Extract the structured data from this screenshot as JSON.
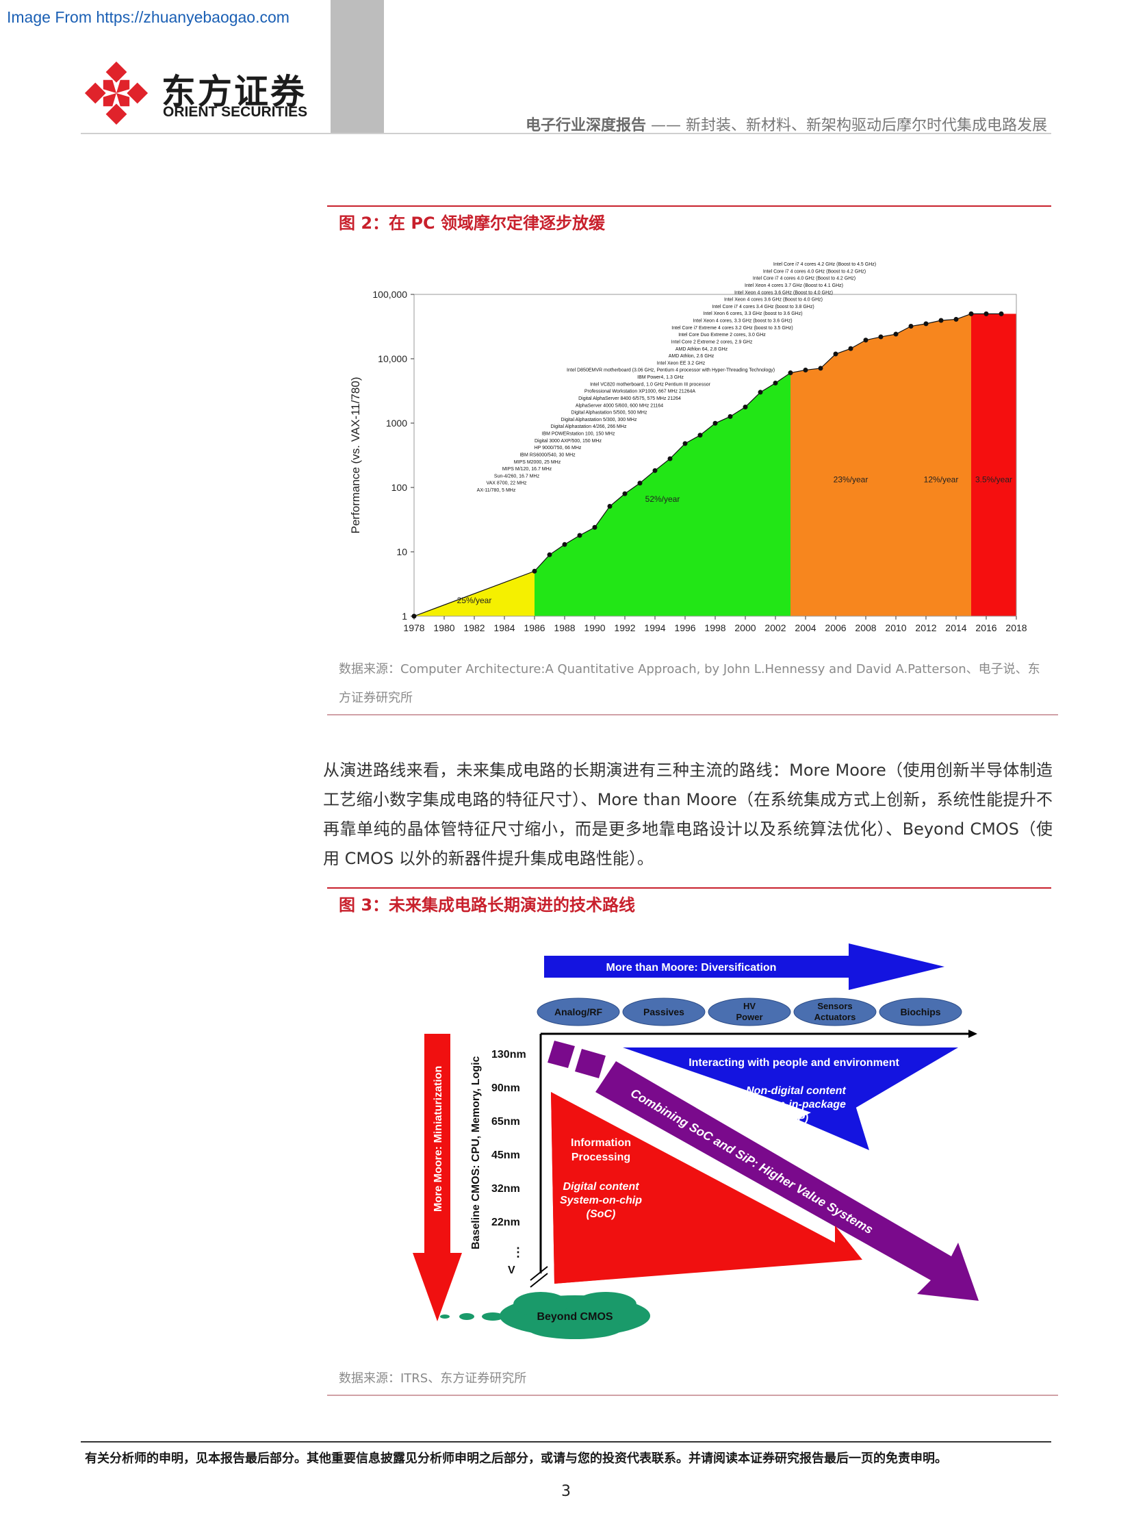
{
  "watermark": "Image From https://zhuanyebaogao.com",
  "logo": {
    "cn": "东方证券",
    "en": "ORIENT SECURITIES",
    "icon": "orient-logo-mark"
  },
  "header": {
    "category": "电子行业深度报告",
    "separator": "——",
    "subtitle": "新封装、新材料、新架构驱动后摩尔时代集成电路发展"
  },
  "figure2": {
    "title": "图 2：在 PC 领域摩尔定律逐步放缓",
    "source": "数据来源：Computer Architecture:A Quantitative Approach, by John L.Hennessy and David A.Patterson、电子说、东方证券研究所"
  },
  "chart_data": [
    {
      "type": "line",
      "scale": "log",
      "ylabel": "Performance (vs. VAX-11/780)",
      "xlabel": "",
      "xlim": [
        1978,
        2018
      ],
      "ylim": [
        1,
        100000
      ],
      "x_ticks": [
        "1978",
        "1980",
        "1982",
        "1984",
        "1986",
        "1988",
        "1990",
        "1992",
        "1994",
        "1996",
        "1998",
        "2000",
        "2002",
        "2004",
        "2006",
        "2008",
        "2010",
        "2012",
        "2014",
        "2016",
        "2018"
      ],
      "y_ticks": [
        "1",
        "10",
        "100",
        "1000",
        "10,000",
        "100,000"
      ],
      "regions": [
        {
          "from": 1978,
          "to": 1986,
          "label": "25%/year",
          "color": "#f5f000"
        },
        {
          "from": 1986,
          "to": 2003,
          "label": "52%/year",
          "color": "#22e616"
        },
        {
          "from": 2003,
          "to": 2011,
          "label": "23%/year",
          "color": "#f7861e"
        },
        {
          "from": 2011,
          "to": 2015,
          "label": "12%/year",
          "color": "#f7861e"
        },
        {
          "from": 2015,
          "to": 2018,
          "label": "3.5%/year",
          "color": "#f50f0f"
        }
      ],
      "points": [
        {
          "x": 1978,
          "y": 1
        },
        {
          "x": 1986,
          "y": 5
        },
        {
          "x": 1987,
          "y": 9
        },
        {
          "x": 1988,
          "y": 13
        },
        {
          "x": 1989,
          "y": 18
        },
        {
          "x": 1990,
          "y": 24
        },
        {
          "x": 1991,
          "y": 51
        },
        {
          "x": 1992,
          "y": 80
        },
        {
          "x": 1993,
          "y": 117
        },
        {
          "x": 1994,
          "y": 183
        },
        {
          "x": 1995,
          "y": 280
        },
        {
          "x": 1996,
          "y": 481
        },
        {
          "x": 1997,
          "y": 649
        },
        {
          "x": 1998,
          "y": 993
        },
        {
          "x": 1999,
          "y": 1267
        },
        {
          "x": 2000,
          "y": 1779
        },
        {
          "x": 2001,
          "y": 3016
        },
        {
          "x": 2002,
          "y": 4195
        },
        {
          "x": 2003,
          "y": 6043
        },
        {
          "x": 2004,
          "y": 6681
        },
        {
          "x": 2005,
          "y": 7108
        },
        {
          "x": 2006,
          "y": 11865
        },
        {
          "x": 2007,
          "y": 14387
        },
        {
          "x": 2008,
          "y": 19484
        },
        {
          "x": 2009,
          "y": 21871
        },
        {
          "x": 2010,
          "y": 24129
        },
        {
          "x": 2011,
          "y": 31999
        },
        {
          "x": 2012,
          "y": 34967
        },
        {
          "x": 2013,
          "y": 39419
        },
        {
          "x": 2014,
          "y": 40967
        },
        {
          "x": 2015,
          "y": 49935
        },
        {
          "x": 2016,
          "y": 49870
        },
        {
          "x": 2017,
          "y": 49935
        }
      ],
      "processor_labels": [
        "Intel Core i7 4 cores 4.2 GHz (Boost to 4.5 GHz)",
        "Intel Core i7 4 cores 4.0 GHz (Boost to 4.2 GHz)",
        "Intel Core i7 4 cores 4.0 GHz (Boost to 4.2 GHz)",
        "Intel Xeon 4 cores 3.7 GHz (Boost to 4.1 GHz)",
        "Intel Xeon 4 cores 3.6 GHz (Boost to 4.0 GHz)",
        "Intel Xeon 4 cores 3.6 GHz (Boost to 4.0 GHz)",
        "Intel Core i7 4 cores 3.4 GHz (boost to 3.8 GHz)",
        "Intel Xeon 6 cores, 3.3 GHz (boost to 3.6 GHz)",
        "Intel Xeon 4 cores, 3.3 GHz (boost to 3.6 GHz)",
        "Intel Core i7 Extreme 4 cores 3.2 GHz (boost to 3.5 GHz)",
        "Intel Core Duo Extreme 2 cores, 3.0 GHz",
        "Intel Core 2 Extreme 2 cores, 2.9 GHz",
        "AMD Athlon 64, 2.8 GHz",
        "AMD Athlon, 2.6 GHz",
        "Intel Xeon EE 3.2 GHz",
        "Intel D850EMVR motherboard (3.06 GHz, Pentium 4 processor with Hyper-Threading Technology)",
        "IBM Power4, 1.3 GHz",
        "Intel VC820 motherboard, 1.0 GHz Pentium III processor",
        "Professional Workstation XP1000, 667 MHz 21264A",
        "Digital AlphaServer 8400 6/575, 575 MHz 21264",
        "AlphaServer 4000 5/600, 600 MHz 21164",
        "Digital Alphastation 5/500, 500 MHz",
        "Digital Alphastation 5/300, 300 MHz",
        "Digital Alphastation 4/266, 266 MHz",
        "IBM POWERstation 100, 150 MHz",
        "Digital 3000 AXP/500, 150 MHz",
        "HP 9000/750, 66 MHz",
        "IBM RS6000/540, 30 MHz",
        "MIPS M2000, 25 MHz",
        "MIPS M/120, 16.7 MHz",
        "Sun-4/260, 16.7 MHz",
        "VAX 8700, 22 MHz",
        "AX-11/780, 5 MHz"
      ]
    }
  ],
  "paragraph": "从演进路线来看，未来集成电路的长期演进有三种主流的路线：More Moore（使用创新半导体制造工艺缩小数字集成电路的特征尺寸）、More than Moore（在系统集成方式上创新，系统性能提升不再靠单纯的晶体管特征尺寸缩小，而是更多地靠电路设计以及系统算法优化）、Beyond CMOS（使用 CMOS 以外的新器件提升集成电路性能）。",
  "figure3": {
    "title": "图 3：未来集成电路长期演进的技术路线",
    "source": "数据来源：ITRS、东方证券研究所",
    "diagram": {
      "top_arrow": "More than Moore:  Diversification",
      "pills": [
        "Analog/RF",
        "Passives",
        "HV Power",
        "Sensors Actuators",
        "Biochips"
      ],
      "left_arrow": "More Moore:  Miniaturization",
      "axis_label": "Baseline CMOS:  CPU, Memory, Logic",
      "nodes": [
        "130nm",
        "90nm",
        "65nm",
        "45nm",
        "32nm",
        "22nm"
      ],
      "blue_triangle": "Interacting with people and environment",
      "blue_sub": "Non-digital content System-in-package (SiP)",
      "red_triangle": "Information Processing",
      "red_sub": "Digital content System-on-chip (SoC)",
      "purple_arrow": "Combining SoC and SiP:  Higher Value Systems",
      "cloud": "Beyond CMOS",
      "colors": {
        "blue": "#1414e0",
        "red": "#f01010",
        "purple": "#7a0a8c",
        "green": "#1a9a6a"
      }
    }
  },
  "footer": {
    "disclaimer": "有关分析师的申明，见本报告最后部分。其他重要信息披露见分析师申明之后部分，或请与您的投资代表联系。并请阅读本证券研究报告最后一页的免责申明。",
    "page": "3"
  }
}
